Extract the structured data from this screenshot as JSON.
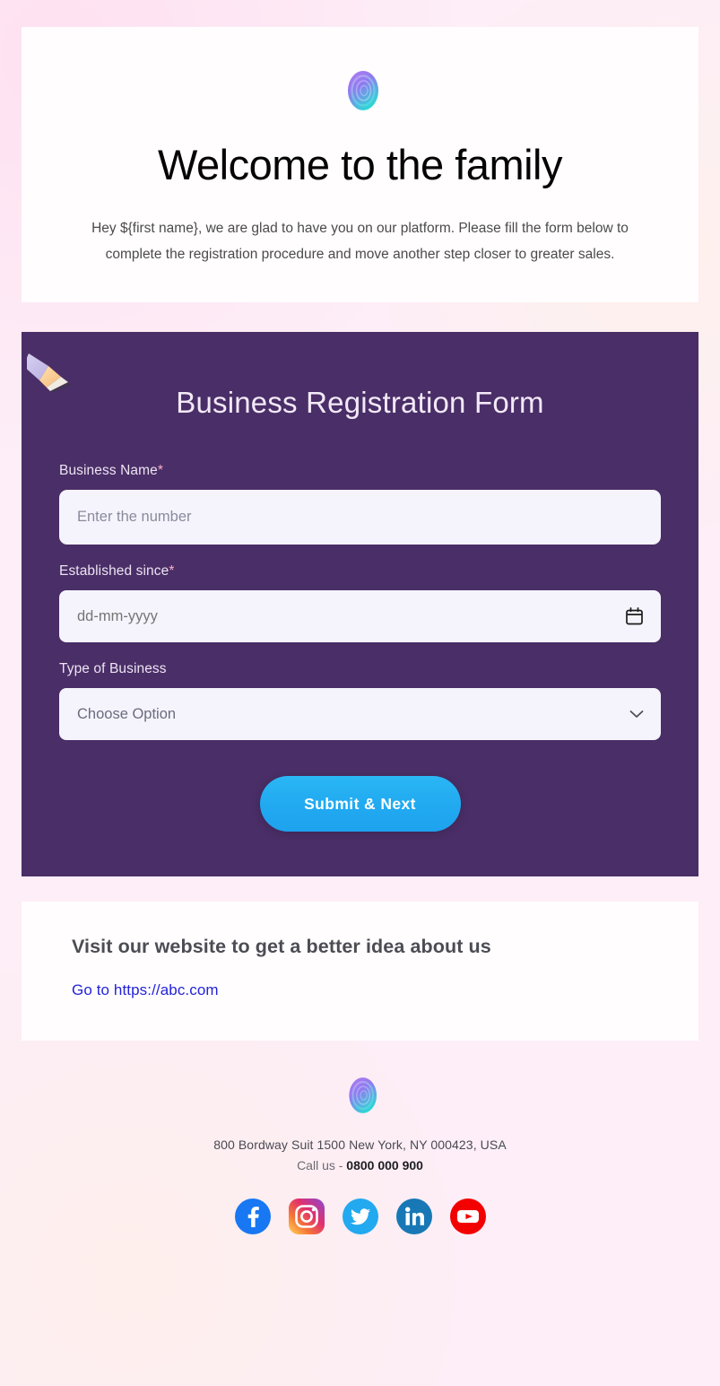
{
  "theme": {
    "page_bg": "#fdeef7",
    "card_bg": "#fffdfe",
    "panel_purple": "#4a2e67",
    "button_blue": "#21a9f0",
    "link_blue": "#2323d8",
    "input_bg": "#f5f4fc"
  },
  "hero": {
    "logo_icon": "spiral-logo-icon",
    "title": "Welcome to the family",
    "body": "Hey ${first name}, we are glad to have you on our platform. Please fill the form below to complete the registration procedure and move another step closer to greater sales."
  },
  "form": {
    "decoration_icon": "pencil-icon",
    "title": "Business Registration Form",
    "fields": [
      {
        "label": "Business Name",
        "required_mark": "*",
        "type": "text",
        "placeholder": "Enter the number",
        "value": ""
      },
      {
        "label": "Established since",
        "required_mark": "*",
        "type": "date",
        "placeholder": "dd-mm-yyyy",
        "value": "",
        "icon": "calendar-icon"
      },
      {
        "label": "Type of Business",
        "required_mark": "",
        "type": "select",
        "placeholder": "Choose Option",
        "value": "Choose Option",
        "icon": "chevron-down-icon"
      }
    ],
    "submit_label": "Submit & Next"
  },
  "website": {
    "heading": "Visit our website to get a better idea about us",
    "link_text": "Go to https://abc.com"
  },
  "footer": {
    "logo_icon": "spiral-logo-icon",
    "address": "800 Bordway Suit 1500 New York, NY 000423, USA",
    "call_prefix": "Call us - ",
    "phone": "0800 000 900",
    "socials": [
      {
        "name": "facebook-icon",
        "color": "#1877f2"
      },
      {
        "name": "instagram-icon",
        "color": "#e1306c"
      },
      {
        "name": "twitter-icon",
        "color": "#1da1f2"
      },
      {
        "name": "linkedin-icon",
        "color": "#0a66c2"
      },
      {
        "name": "youtube-icon",
        "color": "#ff0000"
      }
    ]
  }
}
